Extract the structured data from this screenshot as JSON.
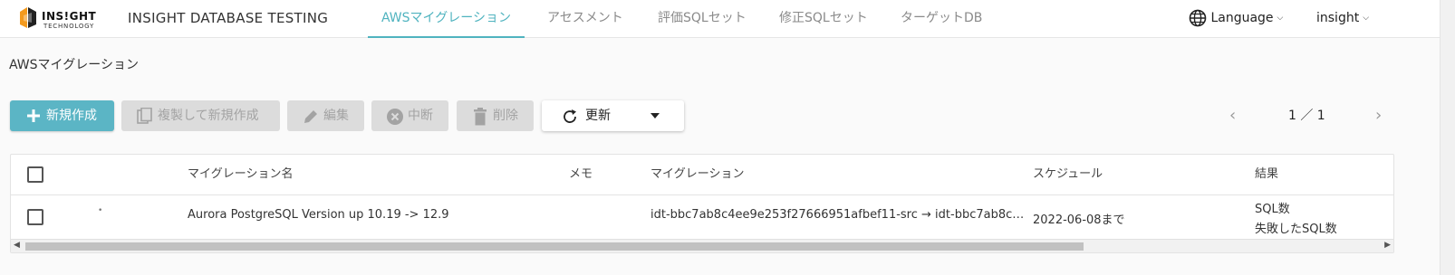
{
  "header": {
    "logo_main": "INS!GHT",
    "logo_sub": "TECHNOLOGY",
    "app_title": "INSIGHT DATABASE TESTING",
    "tabs": [
      {
        "label": "AWSマイグレーション",
        "active": true
      },
      {
        "label": "アセスメント",
        "active": false
      },
      {
        "label": "評価SQLセット",
        "active": false
      },
      {
        "label": "修正SQLセット",
        "active": false
      },
      {
        "label": "ターゲットDB",
        "active": false
      }
    ],
    "language_label": "Language",
    "user_label": "insight",
    "icons": {
      "language": "globe-icon",
      "dropdown": "chevron-down-icon"
    }
  },
  "breadcrumb": {
    "title": "AWSマイグレーション"
  },
  "toolbar": {
    "new_label": "新規作成",
    "copy_new_label": "複製して新規作成",
    "edit_label": "編集",
    "stop_label": "中断",
    "delete_label": "削除",
    "refresh_label": "更新"
  },
  "pager": {
    "text": "1 ／ 1"
  },
  "table": {
    "columns": [
      "マイグレーション名",
      "メモ",
      "マイグレーション",
      "スケジュール",
      "結果"
    ],
    "rows": [
      {
        "marker": "•",
        "name": "Aurora PostgreSQL Version up 10.19 -> 12.9",
        "memo": "",
        "migration": "idt-bbc7ab8c4ee9e253f27666951afbef11-src → idt-bbc7ab8c…",
        "schedule": "2022-06-08まで",
        "result_line1": "SQL数",
        "result_line2": "失敗したSQL数"
      }
    ]
  },
  "colors": {
    "accent": "#4fb3bf",
    "primary_button": "#5bb5c5",
    "disabled_button": "#dcdcdc",
    "logo_orange": "#f39a1e"
  }
}
